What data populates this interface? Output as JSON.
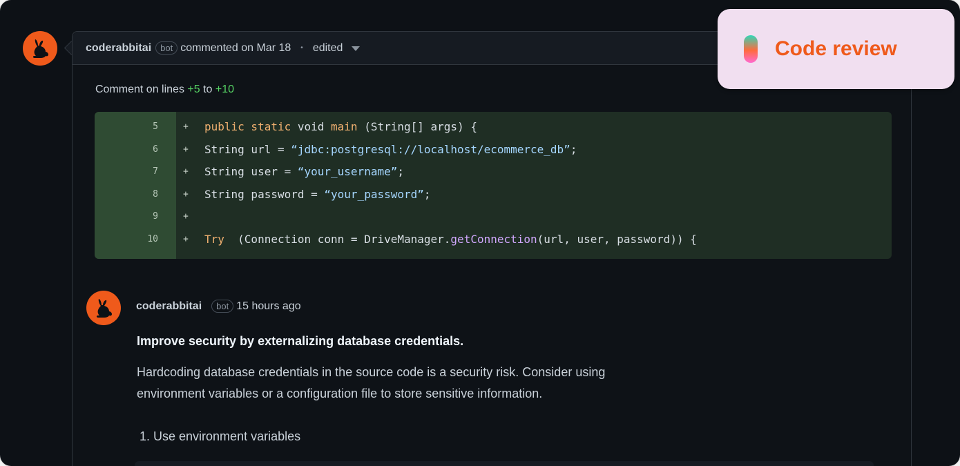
{
  "promo": {
    "label": "Code review",
    "accent": "#ef5a1b",
    "background": "#f1dff0"
  },
  "thread": {
    "author": "coderabbitai",
    "badge": "bot",
    "action": "commented on Mar 18",
    "separator": "•",
    "edited": "edited",
    "caption_prefix": "Comment on lines",
    "caption_from": "+5",
    "caption_mid": "to",
    "caption_to": "+10"
  },
  "diff": {
    "lines": [
      {
        "num": "5",
        "sign": "+",
        "parts": [
          [
            "kw",
            "public static "
          ],
          [
            "",
            "void "
          ],
          [
            "kw",
            "main "
          ],
          [
            "",
            "(String[] args) {"
          ]
        ]
      },
      {
        "num": "6",
        "sign": "+",
        "parts": [
          [
            "",
            "String url = "
          ],
          [
            "str",
            "“jdbc:postgresql://localhost/ecommerce_db”"
          ],
          [
            "",
            ";"
          ]
        ]
      },
      {
        "num": "7",
        "sign": "+",
        "parts": [
          [
            "",
            "String user = "
          ],
          [
            "str",
            "“your_username”"
          ],
          [
            "",
            ";"
          ]
        ]
      },
      {
        "num": "8",
        "sign": "+",
        "parts": [
          [
            "",
            "String password = "
          ],
          [
            "str",
            "“your_password”"
          ],
          [
            "",
            ";"
          ]
        ]
      },
      {
        "num": "9",
        "sign": "+",
        "parts": []
      },
      {
        "num": "10",
        "sign": "+",
        "parts": [
          [
            "kw",
            "Try "
          ],
          [
            "",
            " (Connection conn = DriveManager."
          ],
          [
            "fn",
            "getConnection"
          ],
          [
            "",
            "(url, user, password)) {"
          ]
        ]
      }
    ]
  },
  "reply": {
    "author": "coderabbitai",
    "badge": "bot",
    "time": "15 hours ago",
    "title": "Improve security by externalizing database credentials.",
    "body_line1": "Hardcoding database credentials in the source code is a security risk. Consider using",
    "body_line2": "environment variables or a configuration file to store sensitive information.",
    "list_item": "1. Use environment variables"
  },
  "icons": {
    "avatar": "rabbit-icon",
    "dropdown": "chevron-down-icon",
    "promo": "gradient-pill-icon"
  }
}
